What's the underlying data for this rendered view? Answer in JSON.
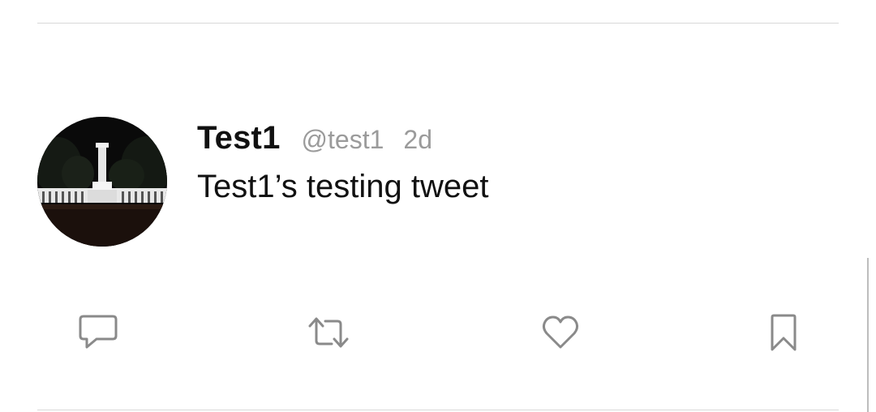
{
  "tweet": {
    "display_name": "Test1",
    "handle": "@test1",
    "timestamp": "2d",
    "text": "Test1’s testing tweet",
    "avatar": {
      "icon": "avatar-image"
    },
    "actions": [
      {
        "name": "reply",
        "icon": "reply-icon"
      },
      {
        "name": "retweet",
        "icon": "retweet-icon"
      },
      {
        "name": "like",
        "icon": "heart-icon"
      },
      {
        "name": "bookmark",
        "icon": "bookmark-icon"
      }
    ]
  },
  "colors": {
    "text_primary": "#111111",
    "text_secondary": "#9b9b9b",
    "icon": "#8a8a8a",
    "divider": "#d8d8d8",
    "background": "#ffffff"
  }
}
